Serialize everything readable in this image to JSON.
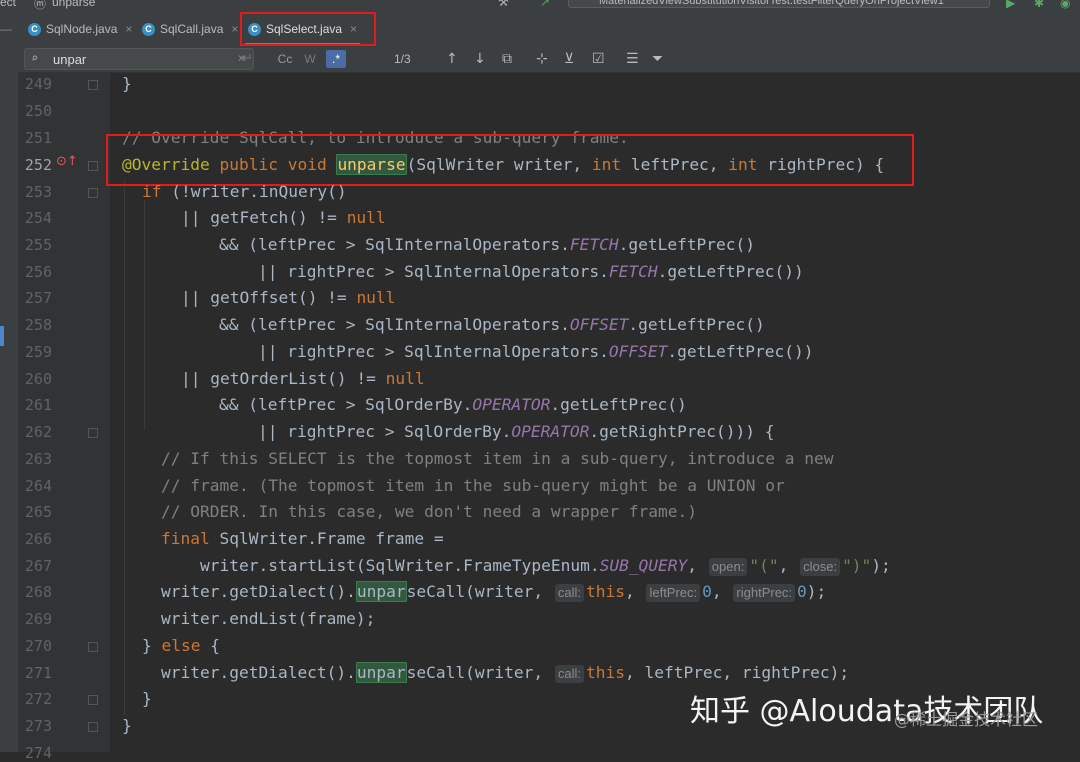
{
  "titlebar": {
    "left_crumb": "ect",
    "method_crumb": "unparse",
    "run_config": "MaterializedViewSubstitutionVisitorTest.testFilterQueryOnProjectView1"
  },
  "tabs": [
    {
      "label": "SqlNode.java",
      "icon": "c-class-icon",
      "active": false
    },
    {
      "label": "SqlCall.java",
      "icon": "c-class-icon",
      "active": false
    },
    {
      "label": "SqlSelect.java",
      "icon": "c-class-icon",
      "active": true
    }
  ],
  "search": {
    "query": "unpar",
    "match_count": "1/3",
    "opt_case": "Cc",
    "opt_regex": ".*"
  },
  "gutter_lines": [
    "249",
    "250",
    "251",
    "252",
    "253",
    "254",
    "255",
    "256",
    "257",
    "258",
    "259",
    "260",
    "261",
    "262",
    "263",
    "264",
    "265",
    "266",
    "267",
    "268",
    "269",
    "270",
    "271",
    "272",
    "273",
    "274"
  ],
  "code": {
    "l249": "}",
    "l251": "// Override SqlCall, to introduce a sub-query frame.",
    "l252_annotation": "@Override",
    "l252_kw1": "public",
    "l252_kw2": "void",
    "l252_name": "unparse",
    "l252_params_a": "(SqlWriter writer, ",
    "l252_int1": "int",
    "l252_params_b": " leftPrec, ",
    "l252_int2": "int",
    "l252_params_c": " rightPrec) {",
    "l253_if": "if",
    "l253_rest": " (!writer.inQuery()",
    "l254_a": "|| getFetch() != ",
    "l254_null": "null",
    "l255_a": "&& (leftPrec > SqlInternalOperators.",
    "l255_f": "FETCH",
    "l255_b": ".getLeftPrec()",
    "l256_a": "|| rightPrec > SqlInternalOperators.",
    "l256_f": "FETCH",
    "l256_b": ".getLeftPrec())",
    "l257_a": "|| getOffset() != ",
    "l257_null": "null",
    "l258_a": "&& (leftPrec > SqlInternalOperators.",
    "l258_f": "OFFSET",
    "l258_b": ".getLeftPrec()",
    "l259_a": "|| rightPrec > SqlInternalOperators.",
    "l259_f": "OFFSET",
    "l259_b": ".getLeftPrec())",
    "l260_a": "|| getOrderList() != ",
    "l260_null": "null",
    "l261_a": "&& (leftPrec > SqlOrderBy.",
    "l261_f": "OPERATOR",
    "l261_b": ".getLeftPrec()",
    "l262_a": "|| rightPrec > SqlOrderBy.",
    "l262_f": "OPERATOR",
    "l262_b": ".getRightPrec())) {",
    "l263": "// If this SELECT is the topmost item in a sub-query, introduce a new",
    "l264": "// frame. (The topmost item in the sub-query might be a UNION or",
    "l265": "// ORDER. In this case, we don't need a wrapper frame.)",
    "l266_kw": "final",
    "l266_rest": " SqlWriter.Frame frame =",
    "l267_a": "writer.startList(SqlWriter.FrameTypeEnum.",
    "l267_f": "SUB_QUERY",
    "l267_b": ",",
    "l267_hint1": "open:",
    "l267_s1": "\"(\"",
    "l267_c": ",",
    "l267_hint2": "close:",
    "l267_s2": "\")\"",
    "l267_d": ");",
    "l268_a": "writer.getDialect().",
    "l268_m1": "unpar",
    "l268_m2": "seCall",
    "l268_b": "(writer,",
    "l268_hint1": "call:",
    "l268_this": "this",
    "l268_c": ",",
    "l268_hint2": "leftPrec:",
    "l268_n1": "0",
    "l268_d": ",",
    "l268_hint3": "rightPrec:",
    "l268_n2": "0",
    "l268_e": ");",
    "l269": "writer.endList(frame);",
    "l270_a": "} ",
    "l270_else": "else",
    "l270_b": " {",
    "l271_a": "writer.getDialect().",
    "l271_m1": "unpar",
    "l271_m2": "seCall",
    "l271_b": "(writer,",
    "l271_hint": "call:",
    "l271_this": "this",
    "l271_c": ", leftPrec, rightPrec);",
    "l272": "}",
    "l273": "}"
  },
  "watermark": {
    "main": "知乎 @Aloudata技术团队",
    "sub": "@稀土掘金技术社区"
  }
}
